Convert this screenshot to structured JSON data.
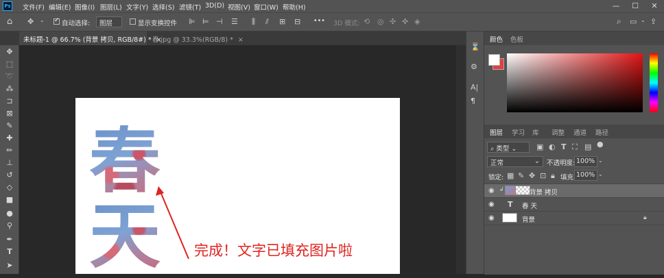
{
  "app": {
    "logo": "Ps",
    "menu": [
      "文件(F)",
      "编辑(E)",
      "图像(I)",
      "图层(L)",
      "文字(Y)",
      "选择(S)",
      "滤镜(T)",
      "3D(D)",
      "视图(V)",
      "窗口(W)",
      "帮助(H)"
    ],
    "window_controls": {
      "minimize": "—",
      "maximize": "☐",
      "close": "✕"
    }
  },
  "options_bar": {
    "auto_select_label": "自动选择:",
    "auto_select_value": "图层",
    "show_transform_label": "显示变换控件",
    "more": "•••",
    "mode_3d": "3D 模式:"
  },
  "tabs": [
    {
      "label": "未标题-1 @ 66.7% (背景 拷贝, RGB/8#) *",
      "close": "×",
      "active": true
    },
    {
      "label": "春.jpg @ 33.3%(RGB/8) *",
      "close": "×",
      "active": false
    }
  ],
  "canvas": {
    "char1": "春",
    "char2": "天",
    "annotation": "完成！文字已填充图片啦",
    "annotation_color": "#e0231e"
  },
  "color_panel": {
    "tabs": [
      "颜色",
      "色板"
    ],
    "foreground": "#ffffff",
    "background": "#e04040"
  },
  "layers_panel": {
    "tabs": [
      "图层",
      "学习",
      "库",
      "调整",
      "通道",
      "路径"
    ],
    "filter_label": "类型",
    "blend_mode": "正常",
    "opacity_label": "不透明度:",
    "opacity_value": "100%",
    "lock_label": "锁定:",
    "fill_label": "填充:",
    "fill_value": "100%",
    "layers": [
      {
        "name": "背景 拷贝",
        "type": "image",
        "selected": true
      },
      {
        "name": "春 天",
        "type": "text",
        "selected": false
      },
      {
        "name": "背景",
        "type": "background",
        "locked": true,
        "selected": false
      }
    ]
  }
}
